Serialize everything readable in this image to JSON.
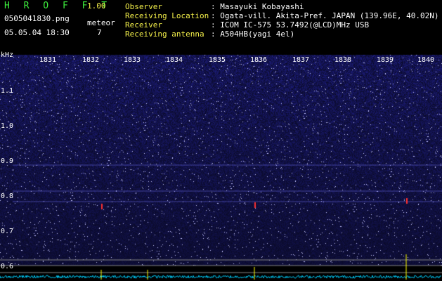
{
  "header": {
    "app_name": "H R O F F T",
    "version": "1.00",
    "filename": "0505041830.png",
    "datetime": "05.05.04 18:30",
    "meteor_label": "meteor",
    "meteor_count": "7"
  },
  "info": [
    {
      "key": "Observer",
      "value": ": Masayuki Kobayashi"
    },
    {
      "key": "Receiving Location",
      "value": ": Ogata-vill. Akita-Pref. JAPAN (139.96E, 40.02N)"
    },
    {
      "key": "Receiver",
      "value": ": ICOM IC-575 53.7492(@LCD)MHz USB"
    },
    {
      "key": "Receiving antenna",
      "value": ": A504HB(yagi 4el)"
    }
  ],
  "axis": {
    "unit": "kHz",
    "y_ticks": [
      "1.1",
      "1.0",
      "0.9",
      "0.8",
      "0.7",
      "0.6"
    ],
    "x_ticks": [
      "1831",
      "1832",
      "1833",
      "1834",
      "1835",
      "1836",
      "1837",
      "1838",
      "1839",
      "1840"
    ]
  },
  "colors": {
    "background": "#000000",
    "spectrum": "#1a1a8a",
    "signal": "#ff3030",
    "baseline": "#00d0ff",
    "peak": "#ffff00",
    "logo": "#3ef03e",
    "label": "#f4f04a"
  }
}
